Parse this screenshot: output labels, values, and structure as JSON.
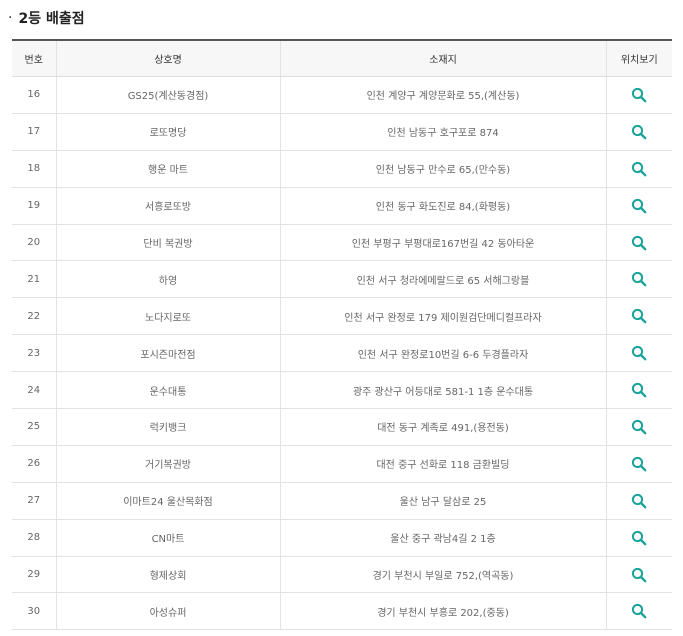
{
  "section": {
    "bullet": "·",
    "title": "2등 배출점"
  },
  "table": {
    "headers": [
      "번호",
      "상호명",
      "소재지",
      "위치보기"
    ],
    "rows": [
      {
        "no": "16",
        "name": "GS25(계산동경점)",
        "address": "인천 계양구 계양문화로 55,(계산동)"
      },
      {
        "no": "17",
        "name": "로또명당",
        "address": "인천 남동구 호구포로 874"
      },
      {
        "no": "18",
        "name": "행운 마트",
        "address": "인천 남동구 만수로 65,(만수동)"
      },
      {
        "no": "19",
        "name": "서흥로또방",
        "address": "인천 동구 화도진로 84,(화평동)"
      },
      {
        "no": "20",
        "name": "단비 복권방",
        "address": "인천 부평구 부평대로167번길 42 동아타운"
      },
      {
        "no": "21",
        "name": "하영",
        "address": "인천 서구 청라에메랄드로 65 서해그랑블"
      },
      {
        "no": "22",
        "name": "노다지로또",
        "address": "인천 서구 완정로 179 제이원검단메디컬프라자"
      },
      {
        "no": "23",
        "name": "포시즌마전점",
        "address": "인천 서구 완정로10번길 6-6 두경플라자"
      },
      {
        "no": "24",
        "name": "운수대통",
        "address": "광주 광산구 어등대로 581-1 1층 운수대통"
      },
      {
        "no": "25",
        "name": "럭키뱅크",
        "address": "대전 동구 계족로 491,(용전동)"
      },
      {
        "no": "26",
        "name": "거기복권방",
        "address": "대전 중구 선화로 118 금환빌딩"
      },
      {
        "no": "27",
        "name": "이마트24 울산목화점",
        "address": "울산 남구 달삼로 25"
      },
      {
        "no": "28",
        "name": "CN마트",
        "address": "울산 중구 곽남4길 2 1층"
      },
      {
        "no": "29",
        "name": "형제상회",
        "address": "경기 부천시 부일로 752,(역곡동)"
      },
      {
        "no": "30",
        "name": "아성슈퍼",
        "address": "경기 부천시 부흥로 202,(중동)"
      }
    ]
  },
  "icons": {
    "map": "search-icon"
  },
  "colors": {
    "icon_teal": "#1aa39a",
    "header_border": "#555555",
    "header_bg": "#f7f7f7"
  }
}
